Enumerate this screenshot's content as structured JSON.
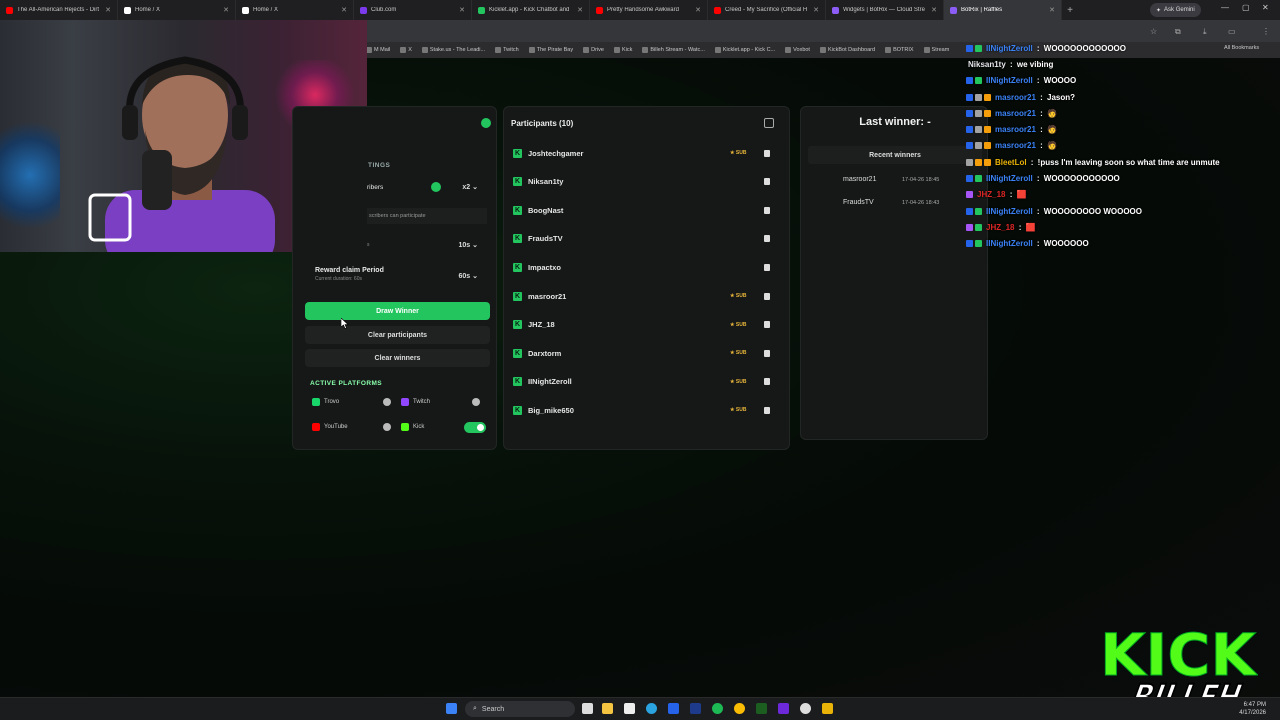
{
  "browser": {
    "tabs": [
      {
        "title": "The All-American Rejects - Dirt",
        "color": "#ff0000"
      },
      {
        "title": "Home / X",
        "color": "#ffffff"
      },
      {
        "title": "Home / X",
        "color": "#ffffff"
      },
      {
        "title": "Club.com",
        "color": "#7c3aed"
      },
      {
        "title": "Kicklet.app - Kick Chatbot and",
        "color": "#22c55e"
      },
      {
        "title": "Pretty Handsome Awkward",
        "color": "#ff0000"
      },
      {
        "title": "Creed - My Sacrifice (Official H",
        "color": "#ff0000"
      },
      {
        "title": "Widgets | BotRix — Cloud Stre",
        "color": "#8b5cf6"
      },
      {
        "title": "BotRix | Raffles",
        "color": "#8b5cf6"
      }
    ],
    "ask_gemini": "Ask Gemini",
    "bookmarks": [
      "M Mail",
      "X",
      "Stake.us - The Leadi...",
      "Twitch",
      "The Pirate Bay",
      "Drive",
      "Kick",
      "Billeh Stream - Watc...",
      "Kicklet.app - Kick C...",
      "Voxbot",
      "KickBot Dashboard",
      "BOTRIX",
      "Stream"
    ],
    "all_bookmarks": "All Bookmarks"
  },
  "raffle": {
    "settings_label": "TINGS",
    "subscribers_label": "ribers",
    "subscribers_multiplier": "x2",
    "subscribers_desc": "scribers can participate",
    "duration_value": "10s",
    "reward_label": "Reward claim Period",
    "reward_desc": "Current duration: 60s",
    "reward_value": "60s",
    "draw_winner": "Draw Winner",
    "clear_participants": "Clear participants",
    "clear_winners": "Clear winners",
    "active_platforms": "ACTIVE PLATFORMS",
    "platforms": [
      {
        "name": "Trovo",
        "on": false,
        "color": "#19d66b"
      },
      {
        "name": "Twitch",
        "on": false,
        "color": "#9146ff"
      },
      {
        "name": "YouTube",
        "on": false,
        "color": "#ff0000"
      },
      {
        "name": "Kick",
        "on": true,
        "color": "#53fc18"
      }
    ],
    "participants_title": "Participants (10)",
    "participants": [
      {
        "name": "Joshtechgamer",
        "sub": true
      },
      {
        "name": "Niksan1ty",
        "sub": false
      },
      {
        "name": "BoogNast",
        "sub": false
      },
      {
        "name": "FraudsTV",
        "sub": false
      },
      {
        "name": "Impactxo",
        "sub": false
      },
      {
        "name": "masroor21",
        "sub": true
      },
      {
        "name": "JHZ_18",
        "sub": true
      },
      {
        "name": "Darxtorm",
        "sub": true
      },
      {
        "name": "IINightZeroll",
        "sub": true
      },
      {
        "name": "Big_mike650",
        "sub": true
      }
    ],
    "sub_label": "SUB",
    "last_winner": "Last winner: -",
    "recent_winners_title": "Recent winners",
    "recent_winners": [
      {
        "name": "masroor21",
        "date": "17-04-26 18:45"
      },
      {
        "name": "FraudsTV",
        "date": "17-04-26 18:43"
      }
    ]
  },
  "chat": [
    {
      "user": "IINightZeroll",
      "msg": "WOOOOOOOOOOOO",
      "ucolor": "#3b82f6",
      "badges": [
        "#2563eb",
        "#22c55e"
      ]
    },
    {
      "user": "Niksan1ty",
      "msg": "we vibing",
      "ucolor": "#e5e7eb",
      "badges": []
    },
    {
      "user": "IINightZeroll",
      "msg": "WOOOO",
      "ucolor": "#3b82f6",
      "badges": [
        "#2563eb",
        "#22c55e"
      ]
    },
    {
      "user": "masroor21",
      "msg": "Jason?",
      "ucolor": "#3b82f6",
      "badges": [
        "#2563eb",
        "#a3a3a3",
        "#f59e0b"
      ]
    },
    {
      "user": "masroor21",
      "msg": "🧑",
      "ucolor": "#3b82f6",
      "badges": [
        "#2563eb",
        "#a3a3a3",
        "#f59e0b"
      ]
    },
    {
      "user": "masroor21",
      "msg": "🧑",
      "ucolor": "#3b82f6",
      "badges": [
        "#2563eb",
        "#a3a3a3",
        "#f59e0b"
      ]
    },
    {
      "user": "masroor21",
      "msg": "🧑",
      "ucolor": "#3b82f6",
      "badges": [
        "#2563eb",
        "#a3a3a3",
        "#f59e0b"
      ]
    },
    {
      "user": "BleetLol",
      "msg": "!puss I'm leaving soon so what time are unmute",
      "ucolor": "#eab308",
      "badges": [
        "#a3a3a3",
        "#f59e0b",
        "#f59e0b"
      ]
    },
    {
      "user": "IINightZeroll",
      "msg": "WOOOOOOOOOOO",
      "ucolor": "#3b82f6",
      "badges": [
        "#2563eb",
        "#22c55e"
      ]
    },
    {
      "user": "JHZ_18",
      "msg": "🟥",
      "ucolor": "#dc2626",
      "badges": [
        "#a855f7"
      ]
    },
    {
      "user": "IINightZeroll",
      "msg": "WOOOOOOOO WOOOOO",
      "ucolor": "#3b82f6",
      "badges": [
        "#2563eb",
        "#22c55e"
      ]
    },
    {
      "user": "JHZ_18",
      "msg": "🟥",
      "ucolor": "#dc2626",
      "badges": [
        "#a855f7",
        "#22c55e"
      ]
    },
    {
      "user": "IINightZeroll",
      "msg": "WOOOOOO",
      "ucolor": "#3b82f6",
      "badges": [
        "#2563eb",
        "#22c55e"
      ]
    }
  ],
  "overlay": {
    "line1": "KICK",
    "line2": "BILLEH"
  },
  "taskbar": {
    "search": "Search",
    "time": "6:47 PM",
    "date": "4/17/2026"
  }
}
